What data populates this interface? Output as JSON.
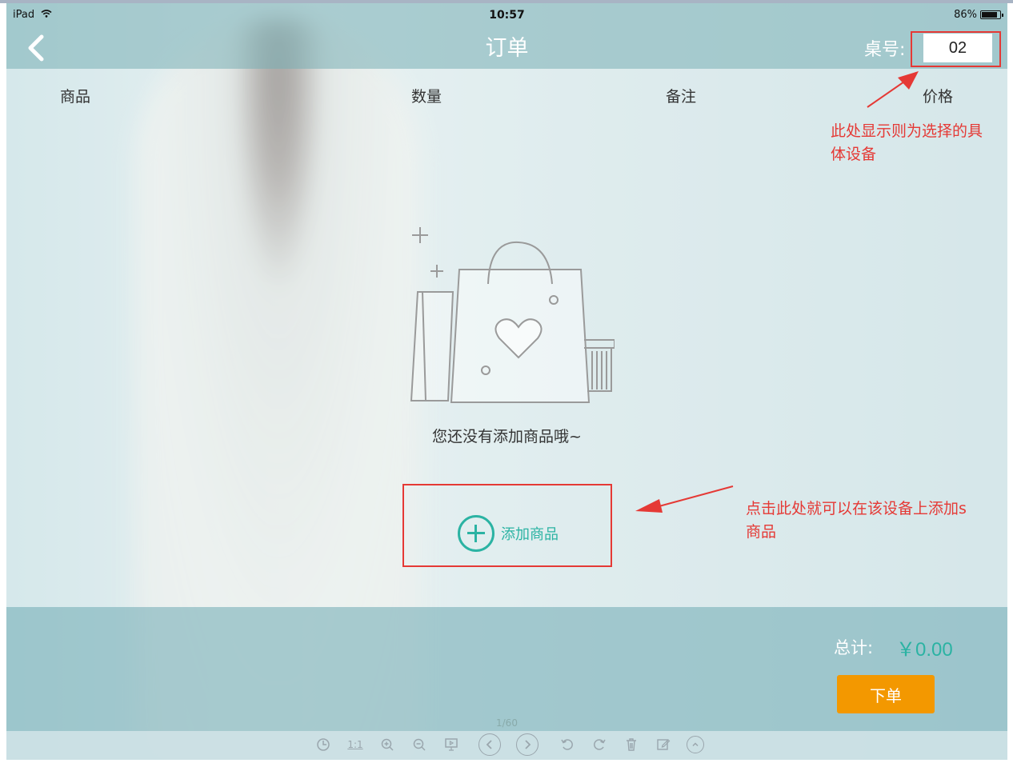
{
  "status_bar": {
    "device": "iPad",
    "time": "10:57",
    "battery": "86%",
    "battery_level": 0.86
  },
  "header": {
    "title": "订单",
    "table_label": "桌号:",
    "table_value": "02"
  },
  "columns": [
    "商品",
    "数量",
    "备注",
    "价格"
  ],
  "empty_state": {
    "message": "您还没有添加商品哦~"
  },
  "add_button": {
    "label": "添加商品"
  },
  "annotations": {
    "table_note": [
      "此处显示则为选择的具",
      "体设备"
    ],
    "add_note": [
      "点击此处就可以在该设备上添加s",
      "商品"
    ],
    "color": "#e53935"
  },
  "footer": {
    "total_label": "总计:",
    "total_value": "￥0.00",
    "order_button": "下单"
  },
  "viewer_toolbar": {
    "page_indicator": "1/60",
    "actual_size_label": "1:1"
  },
  "colors": {
    "accent": "#2bb3a3",
    "order_button": "#f39800",
    "annotation": "#e53935"
  }
}
